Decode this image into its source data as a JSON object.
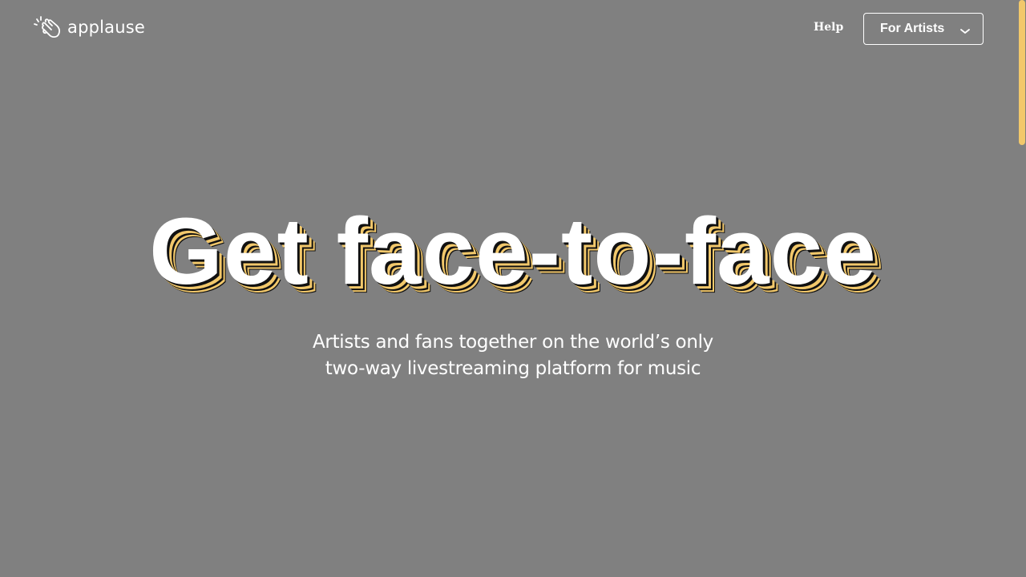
{
  "header": {
    "logo_text": "applause",
    "logo_icon": "clapping-hands-icon",
    "help_label": "Help",
    "artists_button_label": "For Artists",
    "artists_button_icon": "chevron-down-icon"
  },
  "hero": {
    "headline": "Get face-to-face",
    "subhead_line1": "Artists and fans together on the world’s only",
    "subhead_line2": "two-way livestreaming platform for music"
  },
  "colors": {
    "background": "#808080",
    "accent": "#f2c86b",
    "text": "#ffffff"
  }
}
